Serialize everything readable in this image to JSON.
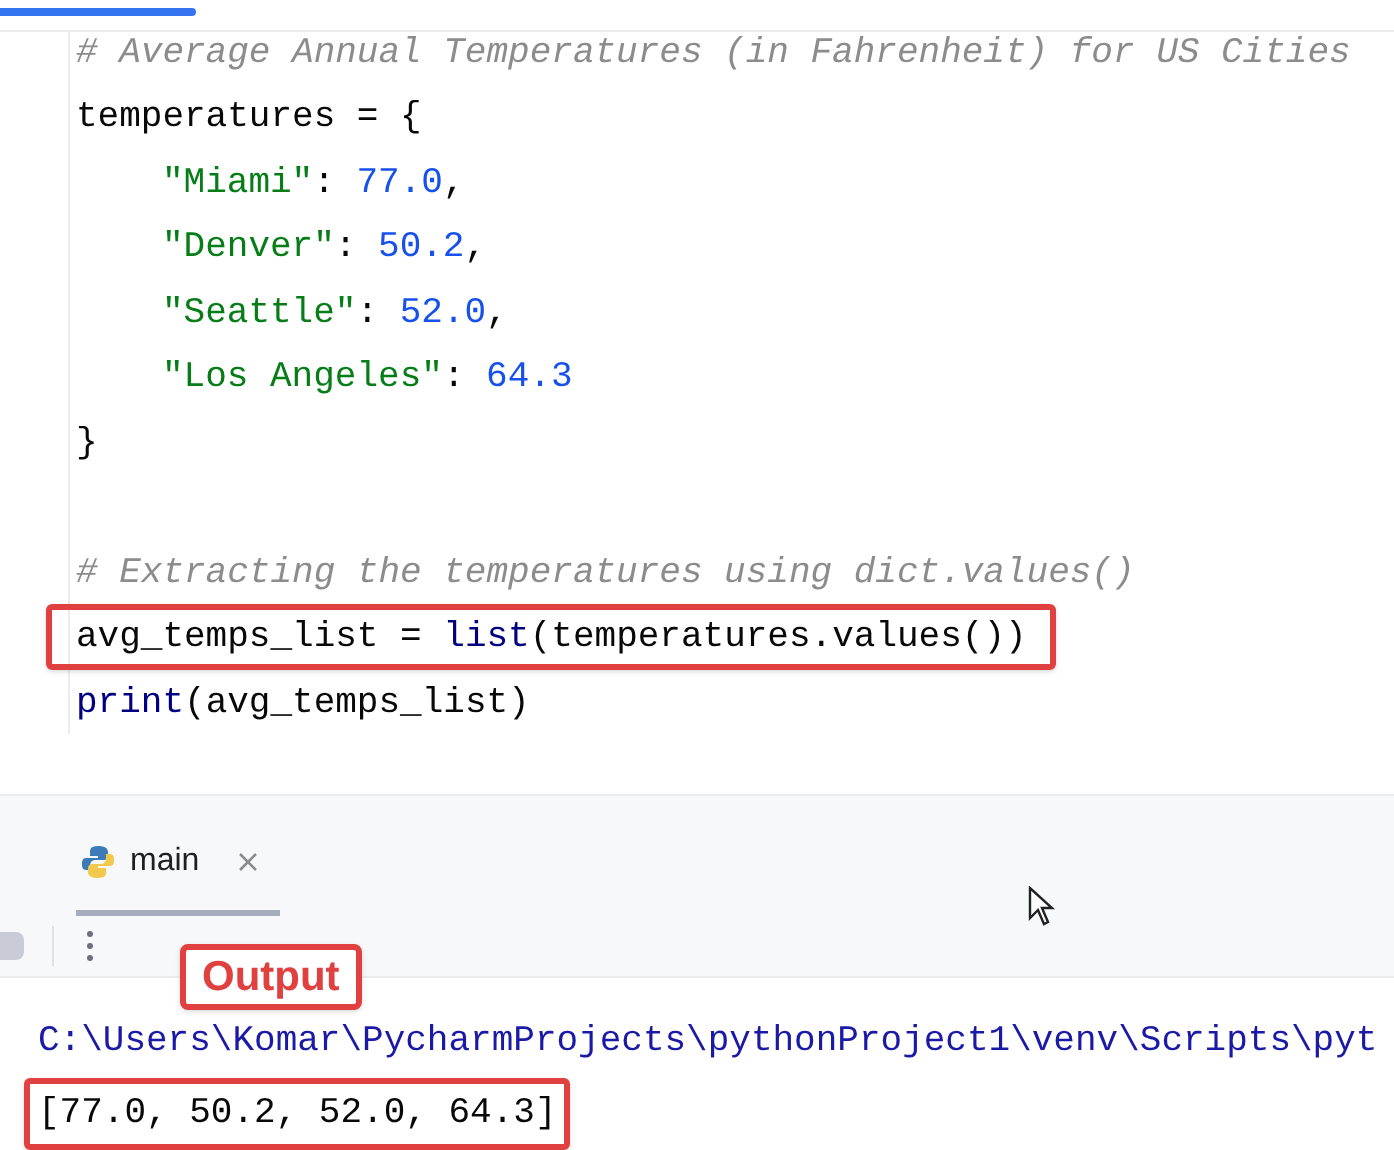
{
  "top_bar": {
    "level": 0.14
  },
  "editor": {
    "lines": [
      {
        "kind": "code",
        "highlighted": false,
        "tokens": [
          {
            "kind": "comment",
            "text": "# Average Annual Temperatures (in Fahrenheit) for US Cities"
          }
        ]
      },
      {
        "kind": "code",
        "highlighted": false,
        "tokens": [
          {
            "kind": "plain",
            "text": "temperatures = {"
          }
        ]
      },
      {
        "kind": "code",
        "highlighted": false,
        "indented": true,
        "tokens": [
          {
            "kind": "string",
            "text": "\"Miami\""
          },
          {
            "kind": "plain",
            "text": ": "
          },
          {
            "kind": "number",
            "text": "77.0"
          },
          {
            "kind": "plain",
            "text": ","
          }
        ]
      },
      {
        "kind": "code",
        "highlighted": false,
        "indented": true,
        "tokens": [
          {
            "kind": "string",
            "text": "\"Denver\""
          },
          {
            "kind": "plain",
            "text": ": "
          },
          {
            "kind": "number",
            "text": "50.2"
          },
          {
            "kind": "plain",
            "text": ","
          }
        ]
      },
      {
        "kind": "code",
        "highlighted": false,
        "indented": true,
        "tokens": [
          {
            "kind": "string",
            "text": "\"Seattle\""
          },
          {
            "kind": "plain",
            "text": ": "
          },
          {
            "kind": "number",
            "text": "52.0"
          },
          {
            "kind": "plain",
            "text": ","
          }
        ]
      },
      {
        "kind": "code",
        "highlighted": false,
        "indented": true,
        "tokens": [
          {
            "kind": "string",
            "text": "\"Los Angeles\""
          },
          {
            "kind": "plain",
            "text": ": "
          },
          {
            "kind": "number",
            "text": "64.3"
          }
        ]
      },
      {
        "kind": "code",
        "highlighted": false,
        "tokens": [
          {
            "kind": "plain",
            "text": "}"
          }
        ]
      },
      {
        "kind": "blank"
      },
      {
        "kind": "code",
        "highlighted": false,
        "tokens": [
          {
            "kind": "comment",
            "text": "# Extracting the temperatures using dict.values()"
          }
        ]
      },
      {
        "kind": "code",
        "highlighted": true,
        "tokens": [
          {
            "kind": "plain",
            "text": "avg_temps_list = "
          },
          {
            "kind": "builtin",
            "text": "list"
          },
          {
            "kind": "plain",
            "text": "(temperatures.values())"
          }
        ]
      },
      {
        "kind": "code",
        "highlighted": false,
        "tokens": [
          {
            "kind": "builtin",
            "text": "print"
          },
          {
            "kind": "plain",
            "text": "(avg_temps_list)"
          }
        ]
      }
    ]
  },
  "run_panel": {
    "tabs": [
      {
        "label": "main",
        "selected": true
      }
    ],
    "console": {
      "callout": "Output",
      "lines": [
        {
          "text": "C:\\Users\\Komar\\PycharmProjects\\pythonProject1\\venv\\Scripts\\pyt",
          "kind": "command",
          "highlighted": false
        },
        {
          "text": "[77.0, 50.2, 52.0, 64.3]",
          "kind": "output",
          "highlighted": true
        }
      ]
    }
  }
}
